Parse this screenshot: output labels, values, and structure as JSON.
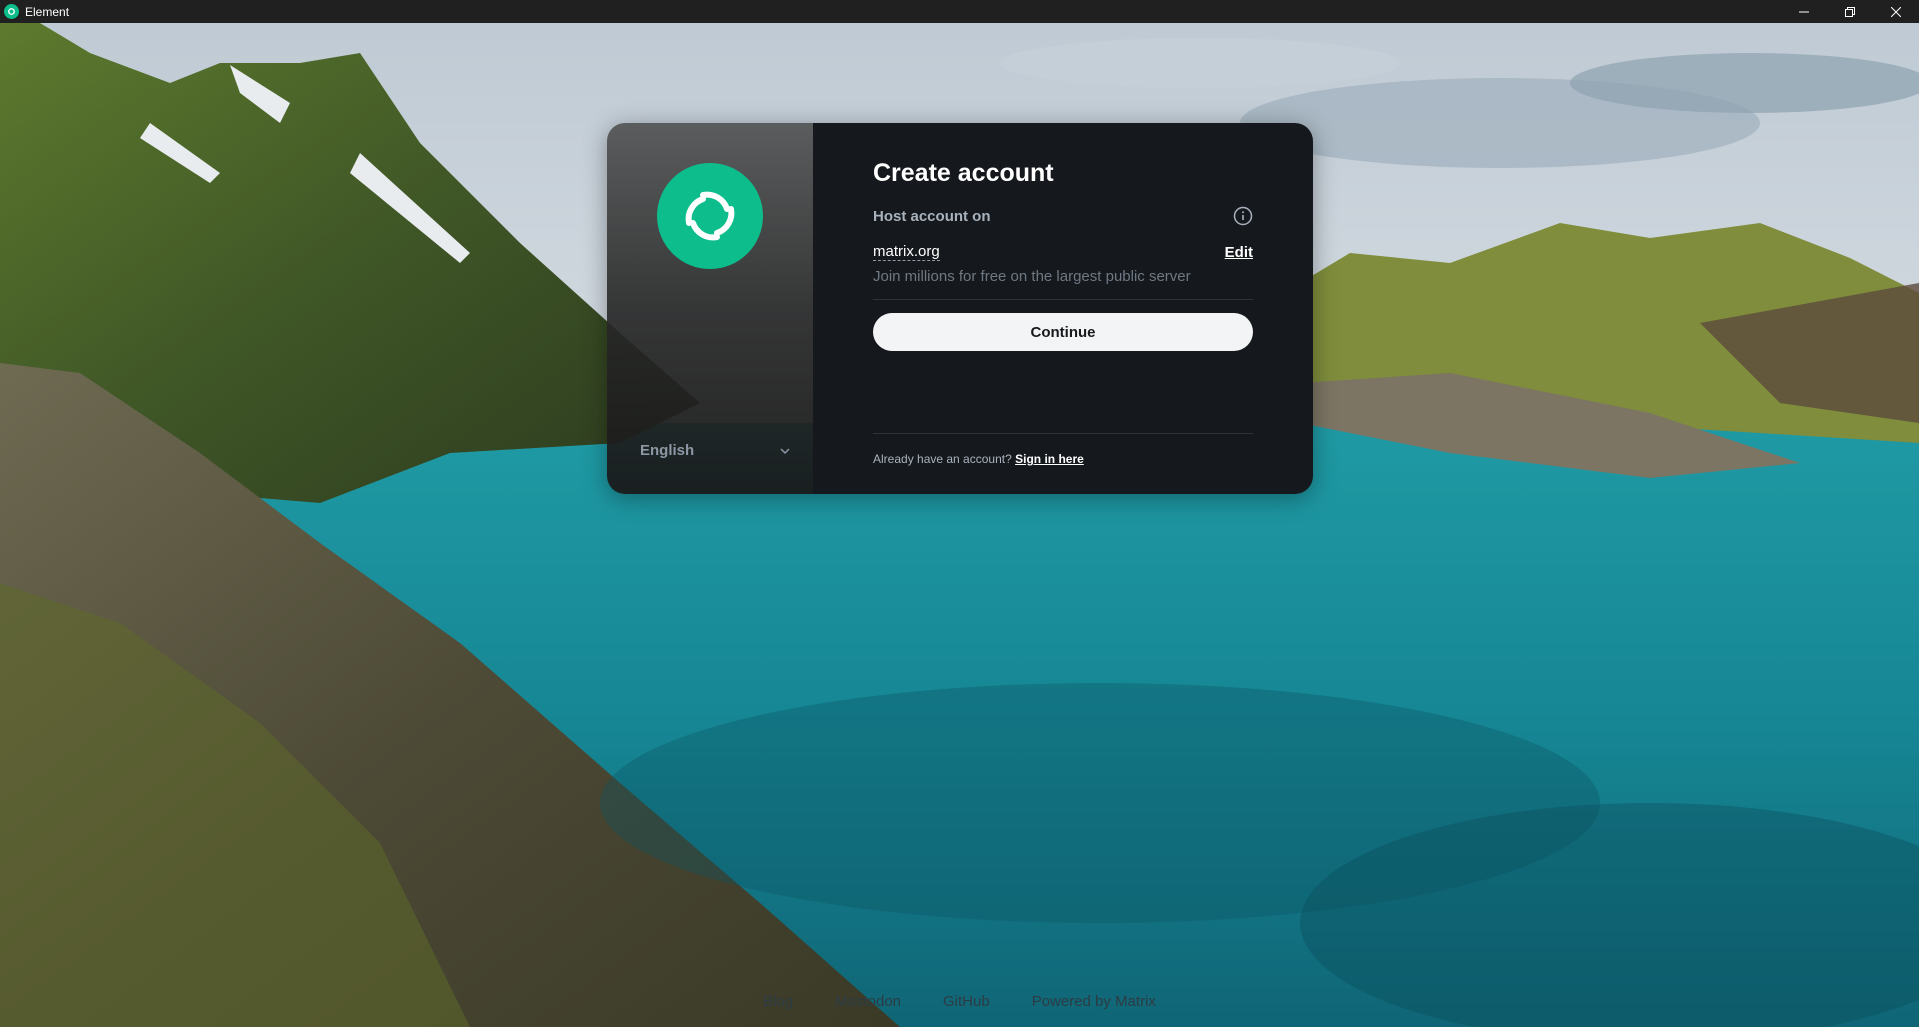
{
  "window": {
    "title": "Element",
    "minimize_icon": "minimize-icon",
    "restore_icon": "restore-icon",
    "close_icon": "close-icon"
  },
  "auth": {
    "logo_icon": "element-logo-icon",
    "language": "English",
    "heading": "Create account",
    "host_label": "Host account on",
    "server_name": "matrix.org",
    "edit_label": "Edit",
    "server_description": "Join millions for free on the largest public server",
    "continue_label": "Continue",
    "already_text": "Already have an account?",
    "sign_in_label": "Sign in here"
  },
  "footer": {
    "links": [
      "Blog",
      "Mastodon",
      "GitHub",
      "Powered by Matrix"
    ]
  },
  "colors": {
    "accent": "#0dbd8b",
    "panel_bg": "#15191e",
    "button_bg": "#f2f4f6"
  }
}
